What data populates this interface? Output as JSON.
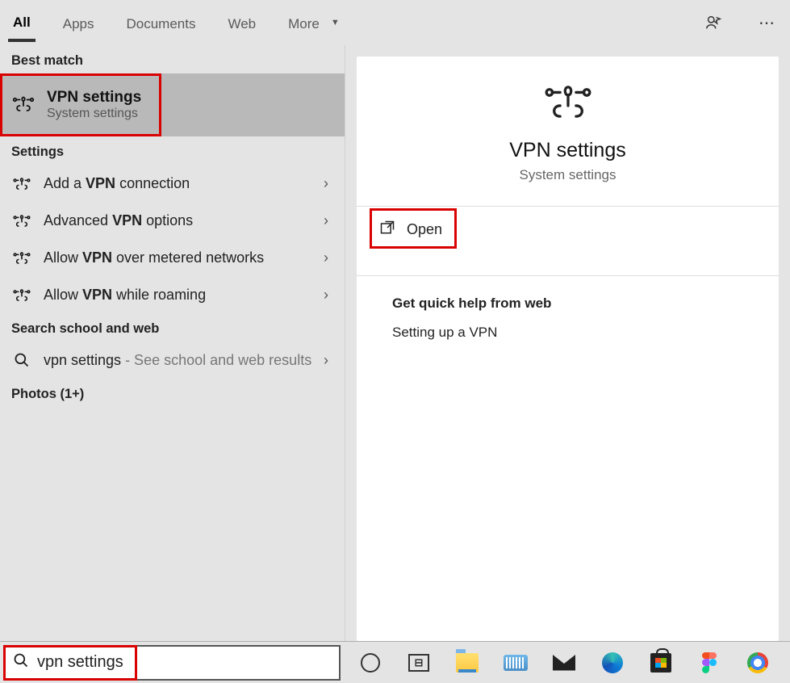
{
  "tabs": {
    "all": "All",
    "apps": "Apps",
    "documents": "Documents",
    "web": "Web",
    "more": "More"
  },
  "sections": {
    "best_match": "Best match",
    "settings": "Settings",
    "search_web": "Search school and web",
    "photos": "Photos (1+)"
  },
  "best_match": {
    "title": "VPN settings",
    "subtitle": "System settings"
  },
  "settings_items": [
    {
      "pre": "Add a ",
      "bold": "VPN",
      "post": " connection"
    },
    {
      "pre": "Advanced ",
      "bold": "VPN",
      "post": " options"
    },
    {
      "pre": "Allow ",
      "bold": "VPN",
      "post": " over metered networks"
    },
    {
      "pre": "Allow ",
      "bold": "VPN",
      "post": " while roaming"
    }
  ],
  "web_search": {
    "term": "vpn settings",
    "suffix": " - See school and web results"
  },
  "preview": {
    "title": "VPN settings",
    "subtitle": "System settings",
    "open": "Open",
    "quick_label": "Get quick help from web",
    "quick_link": "Setting up a VPN"
  },
  "searchbox": {
    "value": "vpn settings"
  }
}
